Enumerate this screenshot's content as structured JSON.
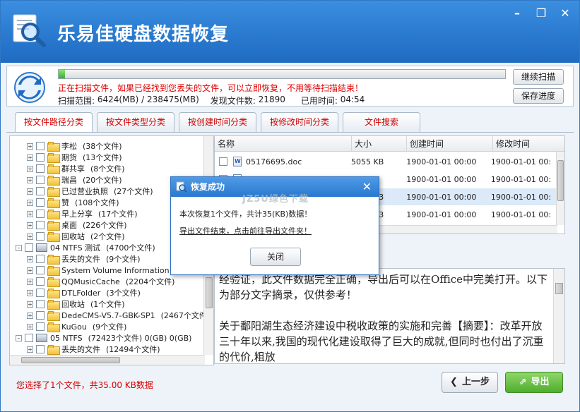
{
  "app": {
    "title": "乐易佳硬盘数据恢复",
    "window_controls": [
      "minimize",
      "restore",
      "close"
    ]
  },
  "scan": {
    "progress_percent": 0.6,
    "message": "正在扫描文件，如果已经找到您丢失的文件，可以立即恢复，不用等待扫描结束！",
    "range_label": "扫描范围:",
    "range_value": "6424(MB) / 238475(MB)",
    "found_label": "发现文件数:",
    "found_value": "21890",
    "time_label": "已用时间:",
    "time_value": "04:54",
    "continue_button": "继续扫描",
    "save_button": "保存进度"
  },
  "tabs": [
    {
      "label": "按文件路径分类",
      "active": true
    },
    {
      "label": "按文件类型分类",
      "active": false
    },
    {
      "label": "按创建时间分类",
      "active": false
    },
    {
      "label": "按修改时间分类",
      "active": false
    },
    {
      "label": "文件搜索",
      "active": false
    }
  ],
  "tree": {
    "rows": [
      {
        "name": "李松",
        "count": "(38个文件)"
      },
      {
        "name": "期货",
        "count": "(13个文件)"
      },
      {
        "name": "群共享",
        "count": "(8个文件)"
      },
      {
        "name": "瑞昌",
        "count": "(20个文件)"
      },
      {
        "name": "已过营业执照",
        "count": "(27个文件)"
      },
      {
        "name": "赞",
        "count": "(108个文件)"
      },
      {
        "name": "早上分享",
        "count": "(17个文件)"
      },
      {
        "name": "桌面",
        "count": "(226个文件)"
      },
      {
        "name": "回收站",
        "count": "(2个文件)"
      },
      {
        "name": "04  NTFS  测试",
        "count": "(4700个文件)"
      },
      {
        "name": "丢失的文件",
        "count": "(9个文件)"
      },
      {
        "name": "System Volume Information",
        "count": ""
      },
      {
        "name": "QQMusicCache",
        "count": "(2204个文件)"
      },
      {
        "name": "DTLFolder",
        "count": "(3个文件)"
      },
      {
        "name": "回收站",
        "count": "(1个文件)"
      },
      {
        "name": "DedeCMS-V5.7-GBK-SP1",
        "count": "(2467个文件)"
      },
      {
        "name": "KuGou",
        "count": "(9个文件)"
      },
      {
        "name": "05  NTFS",
        "count": "(72423个文件) 0(GB) 0(GB)"
      },
      {
        "name": "丢失的文件",
        "count": "(12494个文件)"
      }
    ]
  },
  "filelist": {
    "columns": [
      "名称",
      "大小",
      "创建时间",
      "修改时间"
    ],
    "rows": [
      {
        "name": "05176695.doc",
        "size": "5055 KB",
        "created": "1900-01-01  00:00",
        "modified": "1900-01-01  00:"
      },
      {
        "name": "",
        "size": "",
        "created": "1900-01-01  00:00",
        "modified": "1900-01-01  00:"
      },
      {
        "name": "",
        "size": "3",
        "created": "1900-01-01  00:00",
        "modified": "1900-01-01  00:"
      },
      {
        "name": "",
        "size": "3",
        "created": "1900-01-01  00:00",
        "modified": "1900-01-01  00:"
      },
      {
        "name": "",
        "size": "3",
        "created": "1900-01-01  00:00",
        "modified": "1900-01-01  00:"
      }
    ]
  },
  "preview": {
    "text": "经验证，此文件数据完全正确，导出后可以在Office中完美打开。以下为部分文字摘录，仅供参考！\n\n关于鄱阳湖生态经济建设中税收政策的实施和完善【摘要】：改革开放三十年以来,我国的现代化建设取得了巨大的成就,但同时也付出了沉重的代价,粗放"
  },
  "status": {
    "text": "您选择了1个文件，共35.00 KB数据"
  },
  "nav": {
    "prev_button": "上一步",
    "export_button": "导出"
  },
  "dialog": {
    "title": "恢复成功",
    "message": "本次恢复1个文件，共计35(KB)数据！",
    "link": "导出文件结束，点击前往导出文件夹！",
    "ok_button": "关闭"
  },
  "watermark": "JZ5U绿色下载",
  "colors": {
    "titlebar": "#2a7ad0",
    "accent_red": "#d40000",
    "export_green": "#4fae2e"
  }
}
